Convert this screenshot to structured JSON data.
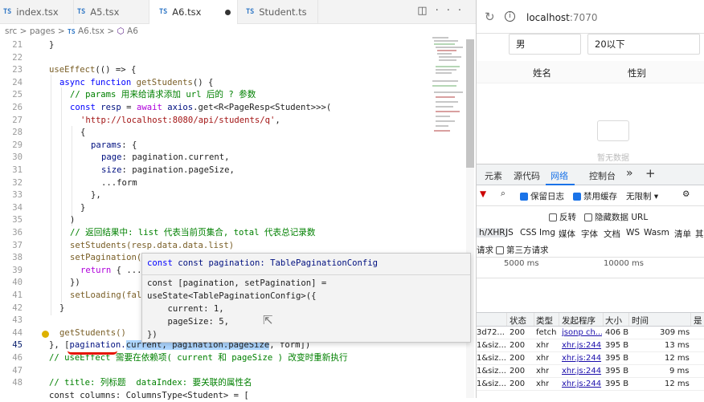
{
  "tabs": [
    {
      "icon": "TS",
      "label": "index.tsx"
    },
    {
      "icon": "TS",
      "label": "A5.tsx"
    },
    {
      "icon": "TS",
      "label": "A6.tsx"
    },
    {
      "icon": "TS",
      "label": "Student.ts"
    }
  ],
  "breadcrumb": {
    "p1": "src",
    "p2": "pages",
    "icon": "TS",
    "p3": "A6.tsx",
    "p4": "A6"
  },
  "hover": {
    "line1": "const pagination: TablePaginationConfig",
    "line2": "const [pagination, setPagination] =",
    "line3": "useState<TablePaginationConfig>({",
    "line4": "    current: 1,",
    "line5": "    pageSize: 5,",
    "line6": "})"
  },
  "browser": {
    "url_host": "localhost",
    "url_port": ":7070",
    "filter1": "男",
    "filter2": "20以下",
    "col1": "姓名",
    "col2": "性别",
    "empty": "暂无数据"
  },
  "devtools": {
    "tabs": [
      "元素",
      "源代码",
      "网络",
      "控制台"
    ],
    "preserve_log": "保留日志",
    "disable_cache": "禁用缓存",
    "throttle": "无限制",
    "invert": "反转",
    "hide_data_url": "隐藏数据 URL",
    "types": [
      "h/XHR",
      "JS",
      "CSS",
      "Img",
      "媒体",
      "字体",
      "文档",
      "WS",
      "Wasm",
      "清单",
      "其"
    ],
    "blocked": "请求",
    "third_party": "第三方请求",
    "timeline": [
      "5000 ms",
      "10000 ms"
    ],
    "headers": [
      "状态",
      "类型",
      "发起程序",
      "大小",
      "时间",
      "是"
    ],
    "rows": [
      {
        "name": "3d72...",
        "status": "200",
        "type": "fetch",
        "initiator": "jsonp ch...",
        "size": "406 B",
        "time": "309 ms"
      },
      {
        "name": "1&siz...",
        "status": "200",
        "type": "xhr",
        "initiator": "xhr.js:244",
        "size": "395 B",
        "time": "13 ms"
      },
      {
        "name": "1&siz...",
        "status": "200",
        "type": "xhr",
        "initiator": "xhr.js:244",
        "size": "395 B",
        "time": "12 ms"
      },
      {
        "name": "1&siz...",
        "status": "200",
        "type": "xhr",
        "initiator": "xhr.js:244",
        "size": "395 B",
        "time": "9 ms"
      },
      {
        "name": "1&siz...",
        "status": "200",
        "type": "xhr",
        "initiator": "xhr.js:244",
        "size": "395 B",
        "time": "12 ms"
      }
    ]
  },
  "code": {
    "l21": "}",
    "l23a": "useEffect",
    "l23b": "(() => {",
    "l24a": "async function ",
    "l24b": "getStudents",
    "l24c": "() {",
    "l25": "// params 用来给请求添加 url 后的 ? 参数",
    "l26a": "const ",
    "l26b": "resp",
    "l26c": " = ",
    "l26d": "await ",
    "l26e": "axios",
    "l26f": ".get<R<PageResp<Student>>>(",
    "l27": "'http://localhost:8080/api/students/q'",
    "l27b": ",",
    "l28": "{",
    "l29a": "params",
    "l29b": ": {",
    "l30a": "page",
    "l30b": ": pagination.current,",
    "l31a": "size",
    "l31b": ": pagination.pageSize,",
    "l32": "...form",
    "l33": "},",
    "l34": "}",
    "l35": ")",
    "l36": "// 返回结果中: list 代表当前页集合, total 代表总记录数",
    "l37": "setStudents(resp.data.data.list)",
    "l38": "setPagination(",
    "l39a": "return ",
    "l39b": "{ ...",
    "l40": "})",
    "l41": "setLoading(fal",
    "l42": "}",
    "l44": "getStudents()",
    "l45a": "}, [",
    "l45b": "pagination.",
    "l45c": "current, pagination.pageSize",
    "l45d": ", form])",
    "l46a": "// ",
    "l46b": "useEffect 需要在依赖项( current 和 pageSize ) 改变时重新执行",
    "l48": "// title: 列标题  dataIndex: 要关联的属性名",
    "l49": "const columns: ColumnsType<Student> = ["
  },
  "line_numbers": [
    "21",
    "22",
    "23",
    "24",
    "25",
    "26",
    "27",
    "28",
    "29",
    "30",
    "31",
    "32",
    "33",
    "34",
    "35",
    "36",
    "37",
    "38",
    "39",
    "40",
    "41",
    "42",
    "43",
    "44",
    "45",
    "46",
    "47",
    "48"
  ]
}
